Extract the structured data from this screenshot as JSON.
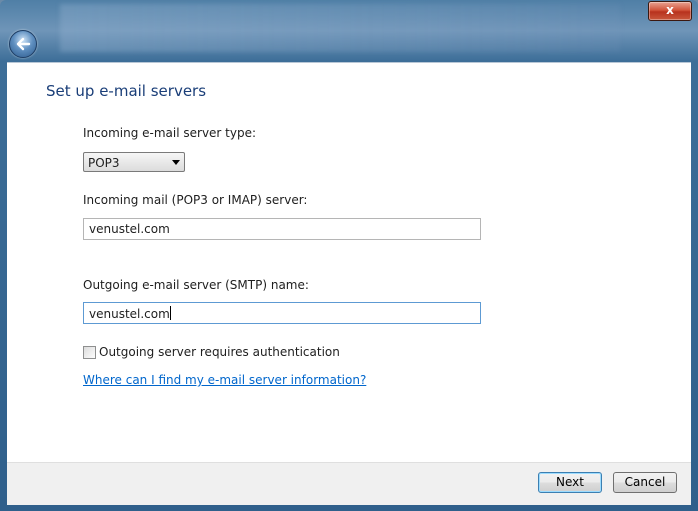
{
  "window": {
    "close_label": "x",
    "back_icon": "back-arrow-icon"
  },
  "page": {
    "title": "Set up e-mail servers"
  },
  "incoming_type": {
    "label": "Incoming e-mail server type:",
    "selected": "POP3"
  },
  "incoming_server": {
    "label": "Incoming mail (POP3 or IMAP) server:",
    "value": "venustel.com"
  },
  "outgoing_server": {
    "label": "Outgoing e-mail server (SMTP) name:",
    "value": "venustel.com"
  },
  "auth": {
    "label": "Outgoing server requires authentication",
    "checked": false
  },
  "help_link": "Where can I find my e-mail server information?",
  "footer": {
    "next_label": "Next",
    "cancel_label": "Cancel"
  },
  "colors": {
    "title_blue": "#1a3e78",
    "link_blue": "#0066cc",
    "close_red": "#c9583c"
  }
}
